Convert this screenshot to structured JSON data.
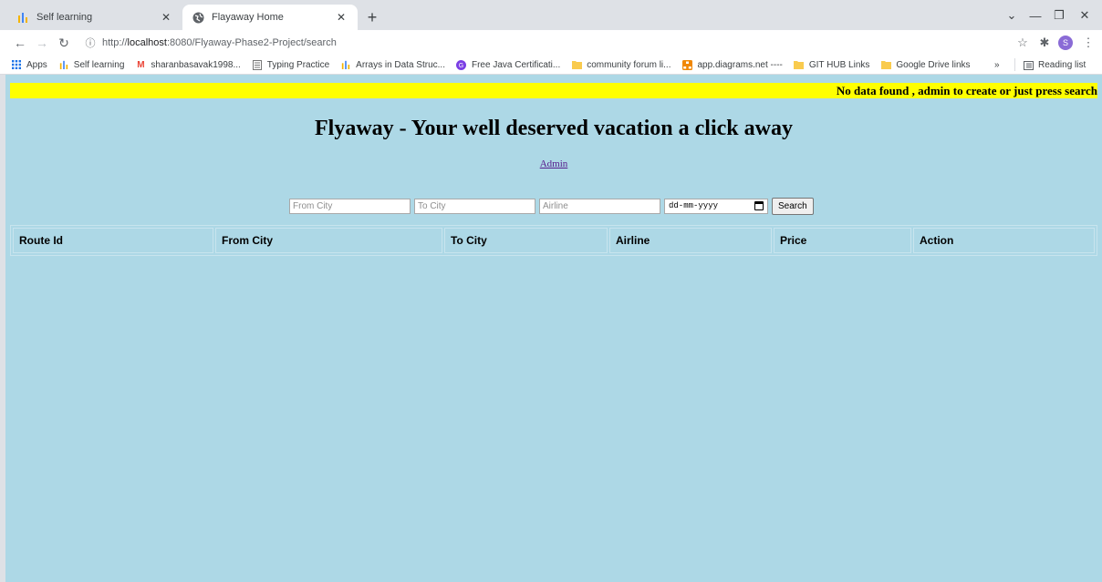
{
  "browser": {
    "tabs": [
      {
        "title": "Self learning",
        "active": false
      },
      {
        "title": "Flayaway Home",
        "active": true
      }
    ],
    "url": {
      "prefix": "http://",
      "host": "localhost",
      "path": ":8080/Flyaway-Phase2-Project/search"
    },
    "bookmarks": [
      {
        "label": "Apps",
        "icon": "apps-grid-icon"
      },
      {
        "label": "Self learning",
        "icon": "bars-icon"
      },
      {
        "label": "sharanbasavak1998...",
        "icon": "gmail-icon"
      },
      {
        "label": "Typing Practice",
        "icon": "page-icon"
      },
      {
        "label": "Arrays in Data Struc...",
        "icon": "bars-icon"
      },
      {
        "label": "Free Java Certificati...",
        "icon": "circle-icon"
      },
      {
        "label": "community forum li...",
        "icon": "folder-icon"
      },
      {
        "label": "app.diagrams.net ----",
        "icon": "diagrams-icon"
      },
      {
        "label": "GIT HUB Links",
        "icon": "folder-icon"
      },
      {
        "label": "Google Drive links",
        "icon": "folder-icon"
      }
    ],
    "overflow": "»",
    "reading_list": "Reading list",
    "profile_initial": "S"
  },
  "page": {
    "banner": "No data found , admin to create or just press search",
    "heading": "Flyaway - Your well deserved vacation a click away",
    "admin_link": "Admin",
    "search": {
      "from_placeholder": "From City",
      "to_placeholder": "To City",
      "airline_placeholder": "Airline",
      "date_placeholder": "dd-mm-yyyy",
      "button": "Search"
    },
    "table": {
      "columns": [
        "Route Id",
        "From City",
        "To City",
        "Airline",
        "Price",
        "Action"
      ]
    }
  },
  "colors": {
    "page_background": "#add8e6",
    "banner_background": "#ffff00",
    "link": "#551a8b"
  }
}
